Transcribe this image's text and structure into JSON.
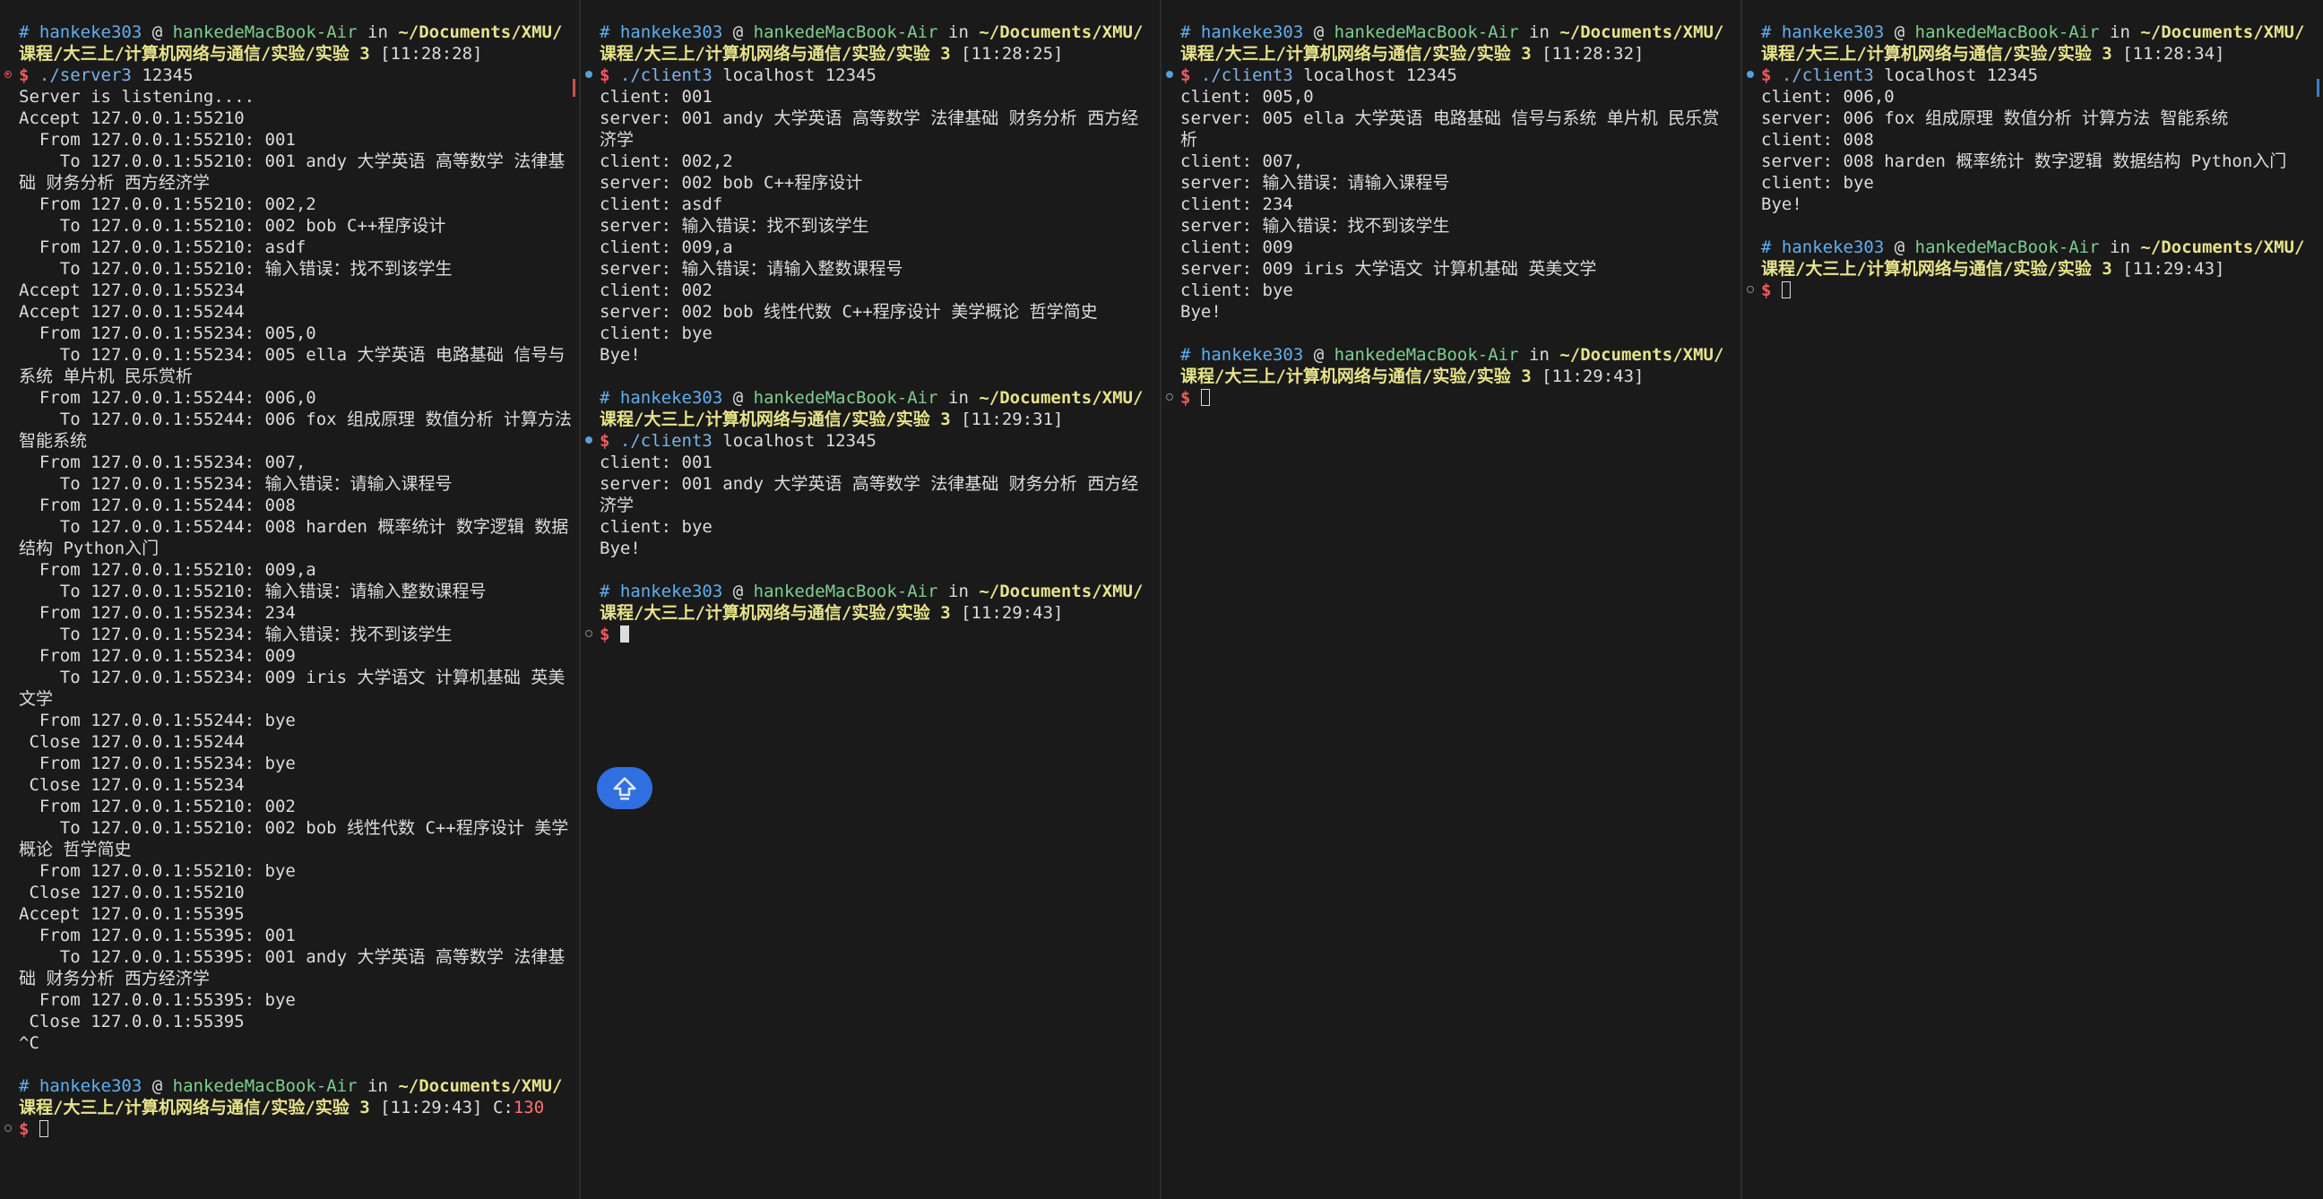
{
  "colors": {
    "accent": "#2f6fe0",
    "user": "#61afef",
    "host": "#7fcf8f",
    "path": "#e7e38b",
    "error": "#ff7070"
  },
  "panes": [
    {
      "name": "server-pane",
      "scroll_color": "#c75050",
      "lines": [
        {
          "type": "header",
          "user": "hankeke303",
          "host": "hankedeMacBook-Air",
          "path": "~/Documents/XMU/课程/大三上/计算机网络与通信/实验/实验 3",
          "time": "[11:28:28]"
        },
        {
          "type": "cmd",
          "mark": "err",
          "cmd": "./server3",
          "args": "12345"
        },
        {
          "text": "Server is listening...."
        },
        {
          "text": "Accept 127.0.0.1:55210"
        },
        {
          "text": "  From 127.0.0.1:55210: 001"
        },
        {
          "text": "    To 127.0.0.1:55210: 001 andy 大学英语 高等数学 法律基础 财务分析 西方经济学"
        },
        {
          "text": "  From 127.0.0.1:55210: 002,2"
        },
        {
          "text": "    To 127.0.0.1:55210: 002 bob C++程序设计"
        },
        {
          "text": "  From 127.0.0.1:55210: asdf"
        },
        {
          "text": "    To 127.0.0.1:55210: 输入错误：找不到该学生"
        },
        {
          "text": "Accept 127.0.0.1:55234"
        },
        {
          "text": "Accept 127.0.0.1:55244"
        },
        {
          "text": "  From 127.0.0.1:55234: 005,0"
        },
        {
          "text": "    To 127.0.0.1:55234: 005 ella 大学英语 电路基础 信号与系统 单片机 民乐赏析"
        },
        {
          "text": "  From 127.0.0.1:55244: 006,0"
        },
        {
          "text": "    To 127.0.0.1:55244: 006 fox 组成原理 数值分析 计算方法 智能系统"
        },
        {
          "text": "  From 127.0.0.1:55234: 007,"
        },
        {
          "text": "    To 127.0.0.1:55234: 输入错误：请输入课程号"
        },
        {
          "text": "  From 127.0.0.1:55244: 008"
        },
        {
          "text": "    To 127.0.0.1:55244: 008 harden 概率统计 数字逻辑 数据结构 Python入门"
        },
        {
          "text": "  From 127.0.0.1:55210: 009,a"
        },
        {
          "text": "    To 127.0.0.1:55210: 输入错误：请输入整数课程号"
        },
        {
          "text": "  From 127.0.0.1:55234: 234"
        },
        {
          "text": "    To 127.0.0.1:55234: 输入错误：找不到该学生"
        },
        {
          "text": "  From 127.0.0.1:55234: 009"
        },
        {
          "text": "    To 127.0.0.1:55234: 009 iris 大学语文 计算机基础 英美文学"
        },
        {
          "text": "  From 127.0.0.1:55244: bye"
        },
        {
          "text": " Close 127.0.0.1:55244"
        },
        {
          "text": "  From 127.0.0.1:55234: bye"
        },
        {
          "text": " Close 127.0.0.1:55234"
        },
        {
          "text": "  From 127.0.0.1:55210: 002"
        },
        {
          "text": "    To 127.0.0.1:55210: 002 bob 线性代数 C++程序设计 美学概论 哲学简史"
        },
        {
          "text": "  From 127.0.0.1:55210: bye"
        },
        {
          "text": " Close 127.0.0.1:55210"
        },
        {
          "text": "Accept 127.0.0.1:55395"
        },
        {
          "text": "  From 127.0.0.1:55395: 001"
        },
        {
          "text": "    To 127.0.0.1:55395: 001 andy 大学英语 高等数学 法律基础 财务分析 西方经济学"
        },
        {
          "text": "  From 127.0.0.1:55395: bye"
        },
        {
          "text": " Close 127.0.0.1:55395"
        },
        {
          "text": "^C"
        },
        {
          "type": "blank"
        },
        {
          "type": "header",
          "user": "hankeke303",
          "host": "hankedeMacBook-Air",
          "path": "~/Documents/XMU/课程/大三上/计算机网络与通信/实验/实验 3",
          "time": "[11:29:43]",
          "exit_label": "C:",
          "exit_code": "130"
        },
        {
          "type": "prompt",
          "mark": "idle",
          "cursor": "hollow"
        }
      ]
    },
    {
      "name": "client-pane-1",
      "lines": [
        {
          "type": "header",
          "user": "hankeke303",
          "host": "hankedeMacBook-Air",
          "path": "~/Documents/XMU/课程/大三上/计算机网络与通信/实验/实验 3",
          "time": "[11:28:25]"
        },
        {
          "type": "cmd",
          "mark": "ok",
          "cmd": "./client3",
          "args": "localhost 12345"
        },
        {
          "text": "client: 001"
        },
        {
          "text": "server: 001 andy 大学英语 高等数学 法律基础 财务分析 西方经济学"
        },
        {
          "text": "client: 002,2"
        },
        {
          "text": "server: 002 bob C++程序设计"
        },
        {
          "text": "client: asdf"
        },
        {
          "text": "server: 输入错误：找不到该学生"
        },
        {
          "text": "client: 009,a"
        },
        {
          "text": "server: 输入错误：请输入整数课程号"
        },
        {
          "text": "client: 002"
        },
        {
          "text": "server: 002 bob 线性代数 C++程序设计 美学概论 哲学简史"
        },
        {
          "text": "client: bye"
        },
        {
          "text": "Bye!"
        },
        {
          "type": "blank"
        },
        {
          "type": "header",
          "user": "hankeke303",
          "host": "hankedeMacBook-Air",
          "path": "~/Documents/XMU/课程/大三上/计算机网络与通信/实验/实验 3",
          "time": "[11:29:31]"
        },
        {
          "type": "cmd",
          "mark": "ok",
          "cmd": "./client3",
          "args": "localhost 12345"
        },
        {
          "text": "client: 001"
        },
        {
          "text": "server: 001 andy 大学英语 高等数学 法律基础 财务分析 西方经济学"
        },
        {
          "text": "client: bye"
        },
        {
          "text": "Bye!"
        },
        {
          "type": "blank"
        },
        {
          "type": "header",
          "user": "hankeke303",
          "host": "hankedeMacBook-Air",
          "path": "~/Documents/XMU/课程/大三上/计算机网络与通信/实验/实验 3",
          "time": "[11:29:43]"
        },
        {
          "type": "prompt",
          "mark": "idle",
          "cursor": "solid"
        }
      ],
      "fab_icon": "input-method-icon"
    },
    {
      "name": "client-pane-2",
      "lines": [
        {
          "type": "header",
          "user": "hankeke303",
          "host": "hankedeMacBook-Air",
          "path": "~/Documents/XMU/课程/大三上/计算机网络与通信/实验/实验 3",
          "time": "[11:28:32]"
        },
        {
          "type": "cmd",
          "mark": "ok",
          "cmd": "./client3",
          "args": "localhost 12345"
        },
        {
          "text": "client: 005,0"
        },
        {
          "text": "server: 005 ella 大学英语 电路基础 信号与系统 单片机 民乐赏析"
        },
        {
          "text": "client: 007,"
        },
        {
          "text": "server: 输入错误：请输入课程号"
        },
        {
          "text": "client: 234"
        },
        {
          "text": "server: 输入错误：找不到该学生"
        },
        {
          "text": "client: 009"
        },
        {
          "text": "server: 009 iris 大学语文 计算机基础 英美文学"
        },
        {
          "text": "client: bye"
        },
        {
          "text": "Bye!"
        },
        {
          "type": "blank"
        },
        {
          "type": "header",
          "user": "hankeke303",
          "host": "hankedeMacBook-Air",
          "path": "~/Documents/XMU/课程/大三上/计算机网络与通信/实验/实验 3",
          "time": "[11:29:43]"
        },
        {
          "type": "prompt",
          "mark": "idle",
          "cursor": "hollow"
        }
      ]
    },
    {
      "name": "client-pane-3",
      "scroll_color": "#3b7fc4",
      "lines": [
        {
          "type": "header",
          "user": "hankeke303",
          "host": "hankedeMacBook-Air",
          "path": "~/Documents/XMU/课程/大三上/计算机网络与通信/实验/实验 3",
          "time": "[11:28:34]"
        },
        {
          "type": "cmd",
          "mark": "ok",
          "cmd": "./client3",
          "args": "localhost 12345"
        },
        {
          "text": "client: 006,0"
        },
        {
          "text": "server: 006 fox 组成原理 数值分析 计算方法 智能系统"
        },
        {
          "text": "client: 008"
        },
        {
          "text": "server: 008 harden 概率统计 数字逻辑 数据结构 Python入门"
        },
        {
          "text": "client: bye"
        },
        {
          "text": "Bye!"
        },
        {
          "type": "blank"
        },
        {
          "type": "header",
          "user": "hankeke303",
          "host": "hankedeMacBook-Air",
          "path": "~/Documents/XMU/课程/大三上/计算机网络与通信/实验/实验 3",
          "time": "[11:29:43]"
        },
        {
          "type": "prompt",
          "mark": "idle",
          "cursor": "hollow"
        }
      ]
    }
  ],
  "prompt": {
    "hash": "#",
    "at": "@",
    "in": "in",
    "dollar": "$"
  }
}
